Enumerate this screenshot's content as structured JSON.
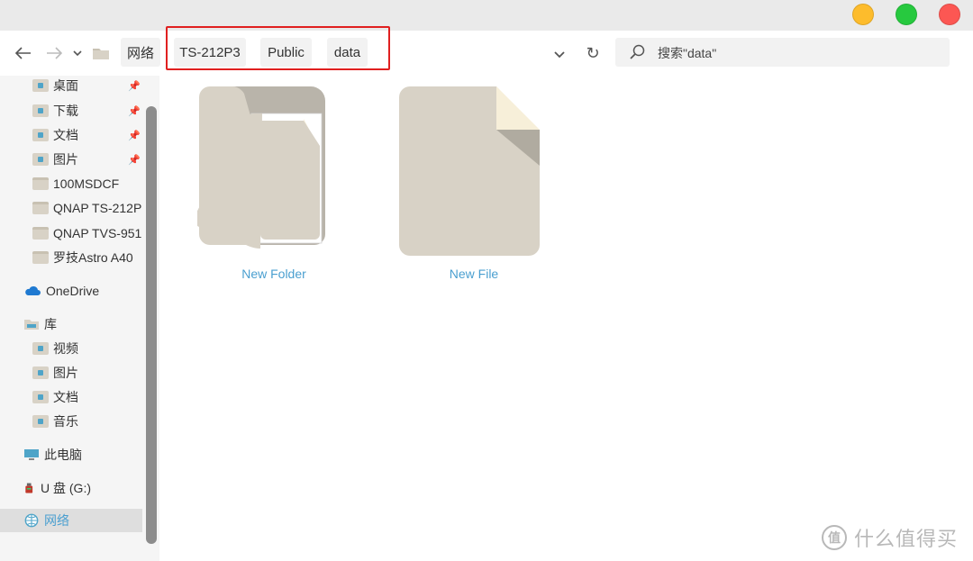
{
  "titlebar": {
    "buttons": [
      "minimize",
      "maximize",
      "close"
    ],
    "colors": {
      "minimize": "#fdbc2c",
      "maximize": "#27c93f",
      "close": "#fc5753"
    }
  },
  "nav": {
    "back_icon": "arrow-left-icon",
    "forward_icon": "arrow-right-icon",
    "recent_icon": "chevron-down-icon",
    "location_icon": "folder-icon",
    "breadcrumbs": [
      "网络",
      "TS-212P3",
      "Public",
      "data"
    ],
    "highlight_color": "#e02020",
    "history_icon": "chevron-down-icon",
    "refresh_icon": "refresh-icon",
    "refresh_glyph": "↻"
  },
  "search": {
    "placeholder": "搜索\"data\""
  },
  "sidebar": {
    "quick_access": [
      {
        "label": "桌面",
        "pinned": true,
        "icon": "desktop-folder-icon"
      },
      {
        "label": "下载",
        "pinned": true,
        "icon": "downloads-folder-icon"
      },
      {
        "label": "文档",
        "pinned": true,
        "icon": "documents-folder-icon"
      },
      {
        "label": "图片",
        "pinned": true,
        "icon": "pictures-folder-icon"
      },
      {
        "label": "100MSDCF",
        "pinned": false,
        "icon": "folder-icon"
      },
      {
        "label": "QNAP TS-212P",
        "pinned": false,
        "icon": "folder-icon"
      },
      {
        "label": "QNAP TVS-951",
        "pinned": false,
        "icon": "folder-icon"
      },
      {
        "label": "罗技Astro A40",
        "pinned": false,
        "icon": "folder-icon"
      }
    ],
    "onedrive": {
      "label": "OneDrive",
      "icon": "onedrive-cloud-icon"
    },
    "library": {
      "label": "库",
      "icon": "library-icon"
    },
    "library_items": [
      {
        "label": "视频",
        "icon": "videos-folder-icon"
      },
      {
        "label": "图片",
        "icon": "pictures-folder-icon"
      },
      {
        "label": "文档",
        "icon": "documents-folder-icon"
      },
      {
        "label": "音乐",
        "icon": "music-folder-icon"
      }
    ],
    "this_pc": {
      "label": "此电脑",
      "icon": "computer-icon"
    },
    "usb": {
      "label": "U 盘 (G:)",
      "icon": "usb-drive-icon"
    },
    "network": {
      "label": "网络",
      "icon": "network-icon",
      "selected": true
    }
  },
  "content": {
    "items": [
      {
        "name": "New Folder",
        "type": "folder",
        "icon": "folder-large-icon"
      },
      {
        "name": "New File",
        "type": "file",
        "icon": "file-large-icon"
      }
    ],
    "label_color": "#4a9fd0"
  },
  "watermark": {
    "icon": "smzdm-logo-icon",
    "badge": "值",
    "text": "什么值得买"
  }
}
